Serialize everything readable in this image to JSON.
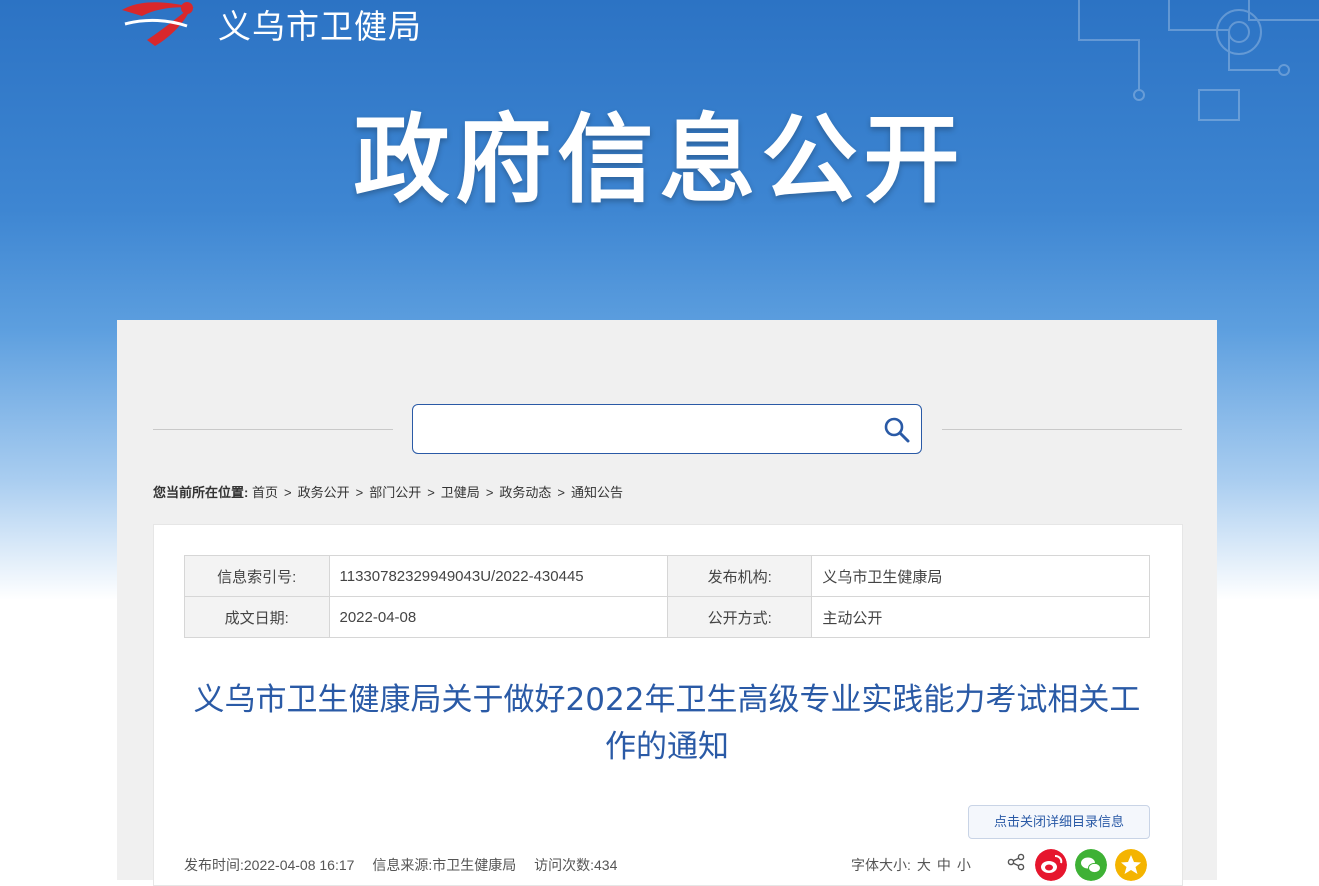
{
  "header": {
    "logo_text": "义乌市卫健局",
    "banner_title": "政府信息公开"
  },
  "search": {
    "placeholder": ""
  },
  "breadcrumb": {
    "label": "您当前所在位置:",
    "items": [
      "首页",
      "政务公开",
      "部门公开",
      "卫健局",
      "政务动态",
      "通知公告"
    ],
    "separator": ">"
  },
  "meta": {
    "index_no_label": "信息索引号:",
    "index_no": "11330782329949043U/2022-430445",
    "publisher_label": "发布机构:",
    "publisher": "义乌市卫生健康局",
    "date_label": "成文日期:",
    "date": "2022-04-08",
    "disclosure_label": "公开方式:",
    "disclosure": "主动公开"
  },
  "article": {
    "title": "义乌市卫生健康局关于做好2022年卫生高级专业实践能力考试相关工作的通知",
    "detail_toggle": "点击关闭详细目录信息",
    "publish_time": "发布时间:2022-04-08 16:17",
    "source": "信息来源:市卫生健康局",
    "visits": "访问次数:434",
    "font_size_label": "字体大小:",
    "font_large": "大",
    "font_medium": "中",
    "font_small": "小"
  },
  "colors": {
    "accent": "#2a5aa6",
    "weibo": "#e6162d",
    "wechat": "#3eb135",
    "qzone": "#f4b400"
  },
  "icons": {
    "search": "search-icon",
    "share": "share-icon",
    "weibo": "weibo-icon",
    "wechat": "wechat-icon",
    "qzone": "qzone-icon"
  }
}
